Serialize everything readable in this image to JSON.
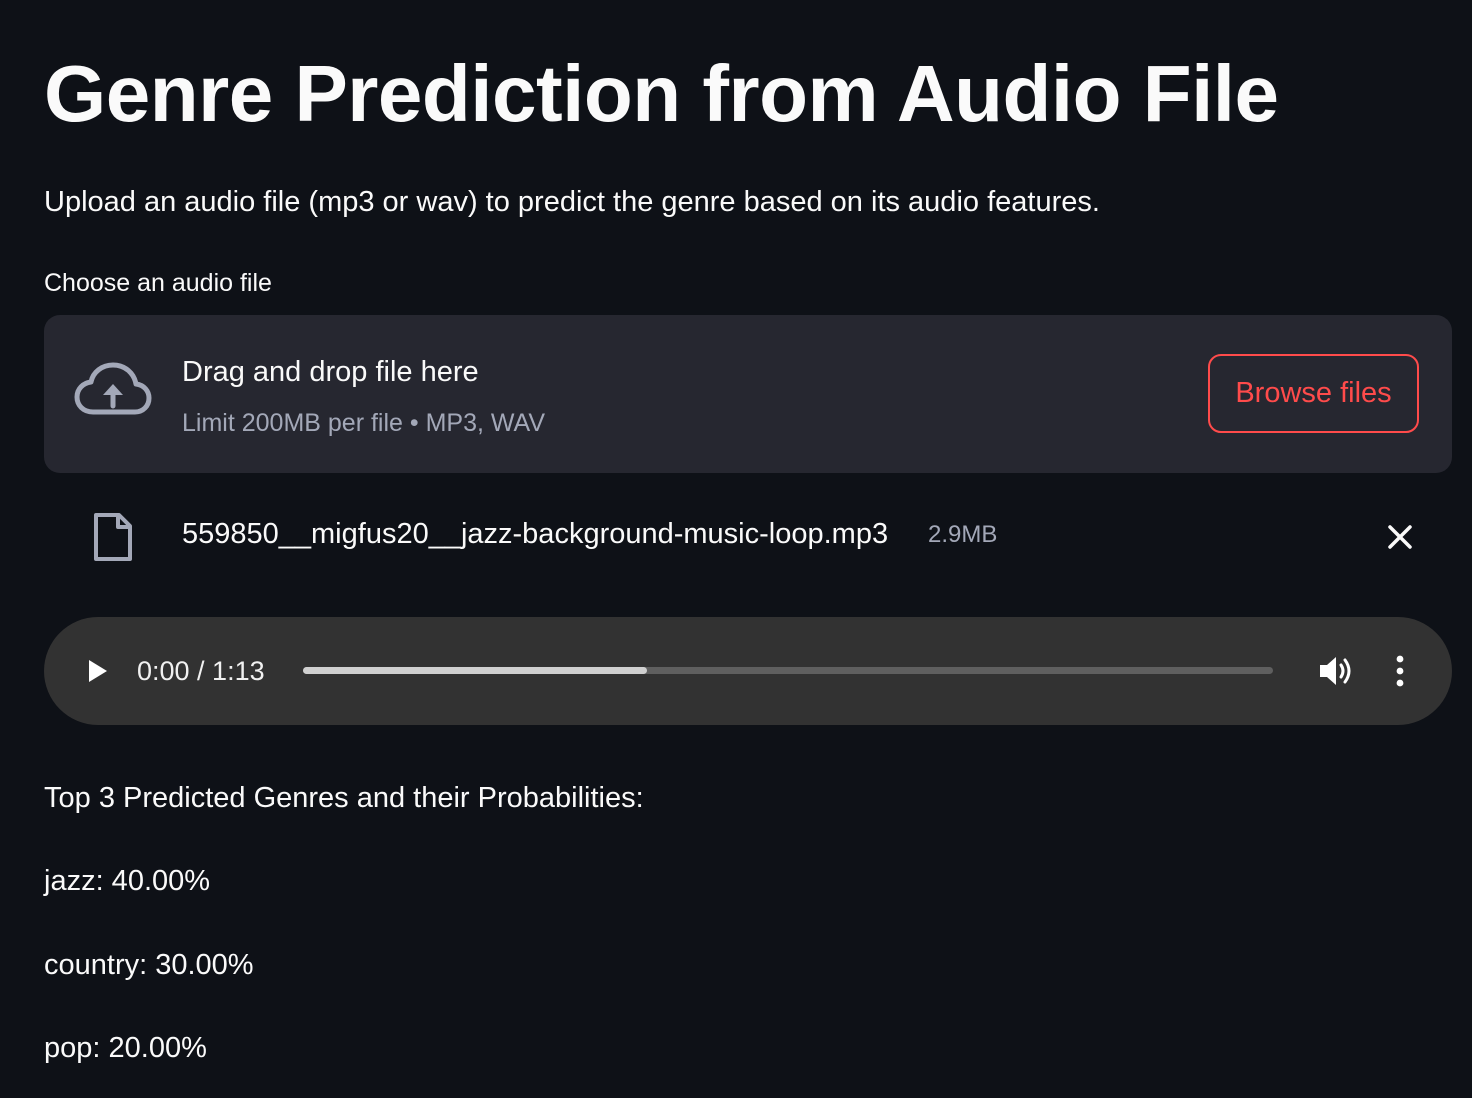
{
  "page": {
    "title": "Genre Prediction from Audio File",
    "description": "Upload an audio file (mp3 or wav) to predict the genre based on its audio features."
  },
  "uploader": {
    "label": "Choose an audio file",
    "drop_text": "Drag and drop file here",
    "limit_text": "Limit 200MB per file • MP3, WAV",
    "browse_label": "Browse files",
    "upload_icon": "cloud-upload-icon"
  },
  "uploaded_file": {
    "name": "559850__migfus20__jazz-background-music-loop.mp3",
    "size": "2.9MB",
    "file_icon": "file-icon",
    "remove_icon": "close-icon"
  },
  "audio_player": {
    "time": "0:00 / 1:13",
    "progress": 0.355,
    "icons": [
      "play-icon",
      "volume-icon",
      "more-vertical-icon"
    ]
  },
  "results": {
    "heading": "Top 3 Predicted Genres and their Probabilities:",
    "items": [
      "jazz: 40.00%",
      "country: 30.00%",
      "pop: 20.00%"
    ]
  },
  "colors": {
    "background": "#0e1117",
    "dropzone": "#262730",
    "accent": "#ff4b4b",
    "player": "#323232",
    "muted_text": "#a3a8b8"
  }
}
